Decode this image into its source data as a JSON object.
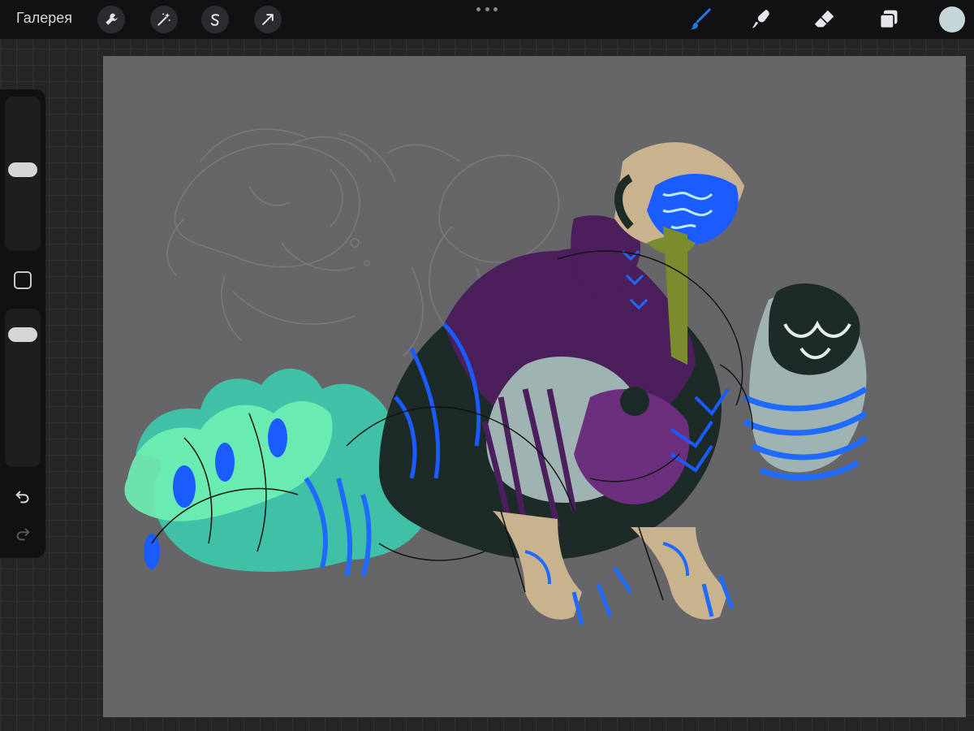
{
  "app": {
    "gallery_label": "Галерея"
  },
  "toolbar": {
    "left_tools": [
      {
        "name": "actions",
        "icon": "wrench-icon"
      },
      {
        "name": "adjustments",
        "icon": "magic-wand-icon"
      },
      {
        "name": "selection",
        "icon": "selection-s-icon"
      },
      {
        "name": "transform",
        "icon": "arrow-cursor-icon"
      }
    ],
    "right_tools": [
      {
        "name": "brush",
        "icon": "brush-icon",
        "active": true
      },
      {
        "name": "smudge",
        "icon": "smudge-icon",
        "active": false
      },
      {
        "name": "eraser",
        "icon": "eraser-icon",
        "active": false
      },
      {
        "name": "layers",
        "icon": "layers-icon",
        "active": false
      }
    ],
    "more_icon": "more-dots-icon",
    "current_color": "#c5d6d8",
    "active_tool_color": "#1f7ae0"
  },
  "sidebar": {
    "brush_size": 0.47,
    "opacity": 0.11,
    "modify_icon": "square-outline-icon",
    "undo_icon": "undo-icon",
    "redo_icon": "redo-icon"
  },
  "canvas": {
    "background": "#666668",
    "colors": {
      "mint": "#6ff0b4",
      "teal": "#3fc0a7",
      "blue": "#1a5cff",
      "bright_blue": "#1f6bff",
      "purple": "#4a1f5c",
      "violet": "#6b2f7e",
      "dark": "#1c2b27",
      "olive": "#7a8c2e",
      "bone": "#c9b38f",
      "pale": "#9fb3b3",
      "sketch": "#7c7c82"
    }
  }
}
